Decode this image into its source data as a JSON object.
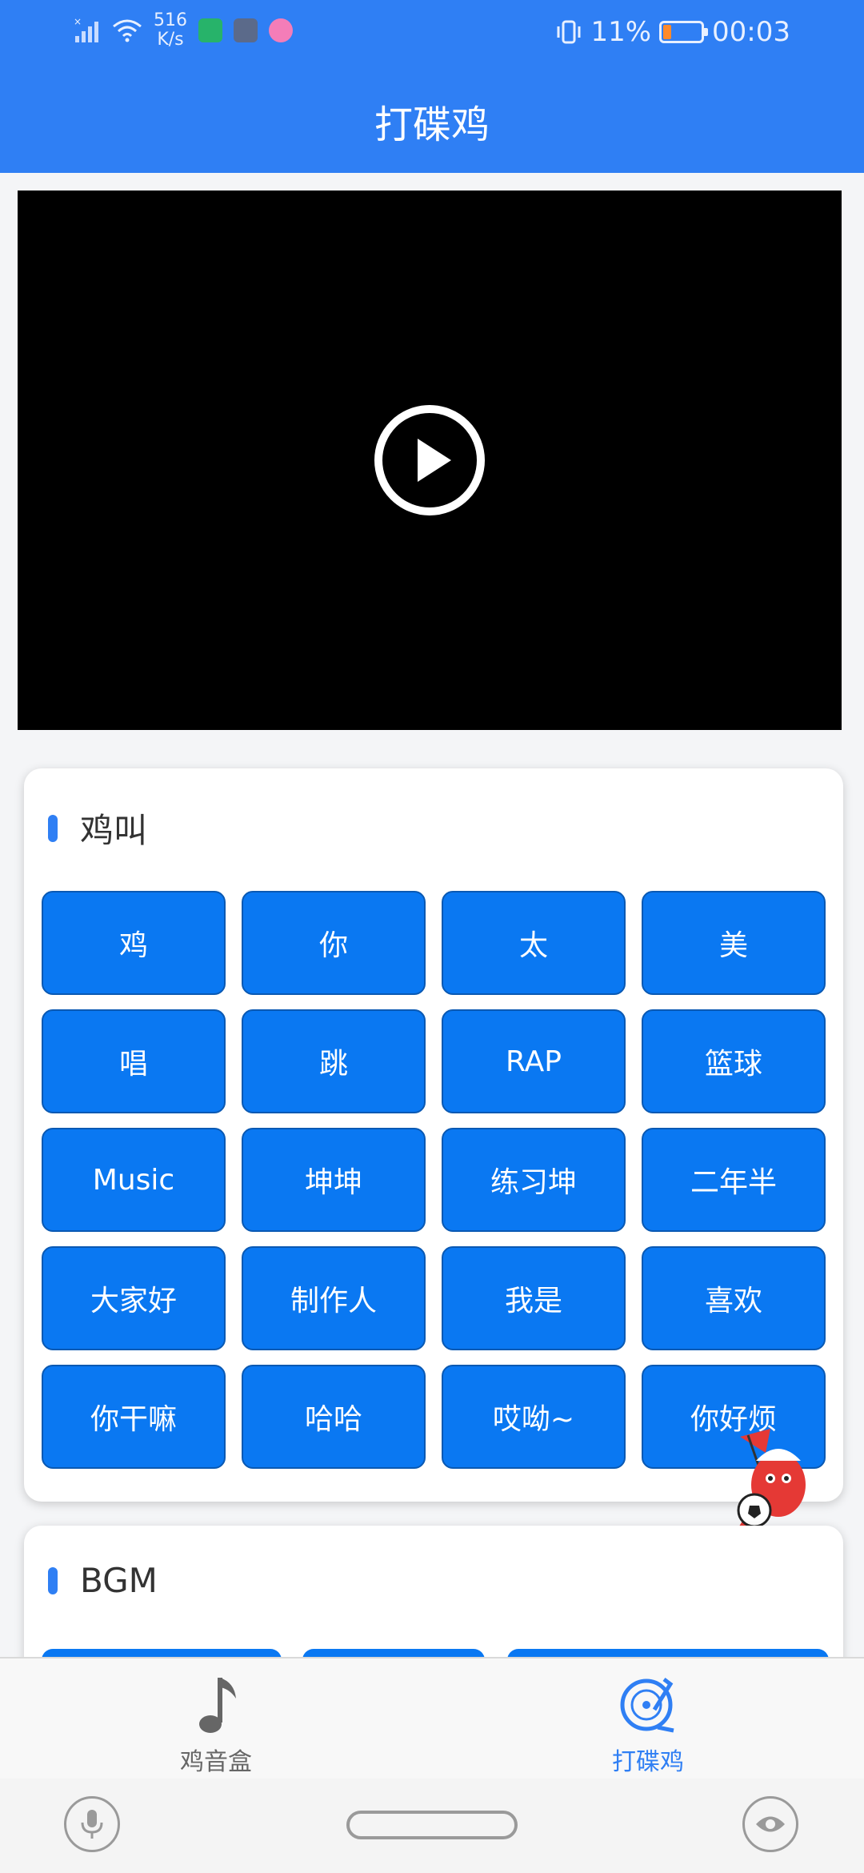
{
  "status_bar": {
    "net_speed_value": "516",
    "net_speed_unit": "K/s",
    "battery": "11%",
    "time": "00:03",
    "battery_level": 0.11
  },
  "header": {
    "title": "打碟鸡"
  },
  "video": {
    "play_icon": "play-circle-icon"
  },
  "card_sounds": {
    "title": "鸡叫",
    "buttons": [
      "鸡",
      "你",
      "太",
      "美",
      "唱",
      "跳",
      "RAP",
      "篮球",
      "Music",
      "坤坤",
      "练习坤",
      "二年半",
      "大家好",
      "制作人",
      "我是",
      "喜欢",
      "你干嘛",
      "哈哈",
      "哎呦~",
      "你好烦"
    ]
  },
  "card_bgm": {
    "title": "BGM"
  },
  "bottom_nav": {
    "items": [
      {
        "label": "鸡音盒",
        "icon": "music-note-icon",
        "active": false
      },
      {
        "label": "打碟鸡",
        "icon": "turntable-icon",
        "active": true
      }
    ]
  },
  "colors": {
    "primary": "#2f7ff4",
    "button": "#0a78f2",
    "inactive": "#666666"
  }
}
